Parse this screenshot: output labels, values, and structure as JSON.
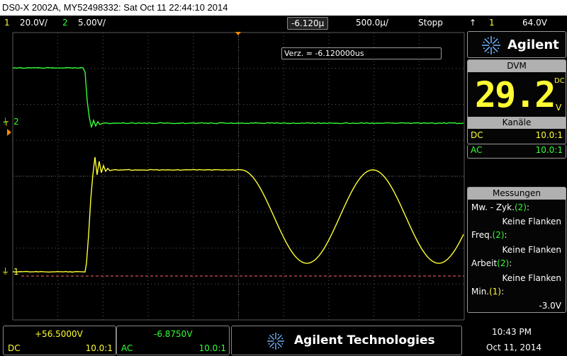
{
  "window": {
    "title": "DS0-X 2002A, MY52498332: Sat Oct 11 22:44:10 2014"
  },
  "status": {
    "ch1_num": "1",
    "ch1_scale": "20.0V/",
    "ch2_num": "2",
    "ch2_scale": "5.00V/",
    "time_offset": "-6.120µ",
    "time_scale": "500.0µ/",
    "run_state": "Stopp",
    "trig_source": "1",
    "trig_level": "64.0V"
  },
  "scope": {
    "delay_readout": "Verz. = -6.120000us",
    "ch1_marker": "1",
    "ch2_marker": "2",
    "trig_marker": "T",
    "colors": {
      "ch1": "#ffff33",
      "ch2": "#33ff33",
      "grid": "#5a5a5a",
      "ref": "#ff6666"
    }
  },
  "panel": {
    "brand": "Agilent",
    "logo_icon": "agilent-spark-icon",
    "dvm_header": "DVM",
    "dvm_value": "29.2",
    "dvm_mode": "DC",
    "dvm_unit": "V",
    "channels_header": "Kanäle",
    "ch1_coupling": "DC",
    "ch1_probe": "10.0:1",
    "ch2_coupling": "AC",
    "ch2_probe": "10.0:1",
    "measure_header": "Messungen",
    "m1_label": "Mw. - Zyk.",
    "m1_src": "(2)",
    "m1_colon": ":",
    "m1_value": "Keine Flanken",
    "m2_label": "Freq.",
    "m2_src": "(2)",
    "m2_colon": ":",
    "m2_value": "Keine Flanken",
    "m3_label": "Arbeit",
    "m3_src": "(2)",
    "m3_colon": ":",
    "m3_value": "Keine Flanken",
    "m4_label": "Min.",
    "m4_src": "(1)",
    "m4_colon": ":",
    "m4_value": "-3.0V"
  },
  "bottom": {
    "ch1_offset": "+56.5000V",
    "ch1_coupling": "DC",
    "ch1_probe": "10.0:1",
    "ch2_offset": "-6.8750V",
    "ch2_coupling": "AC",
    "ch2_probe": "10.0:1",
    "brand_full": "Agilent Technologies",
    "time": "10:43 PM",
    "date": "Oct 11, 2014"
  }
}
